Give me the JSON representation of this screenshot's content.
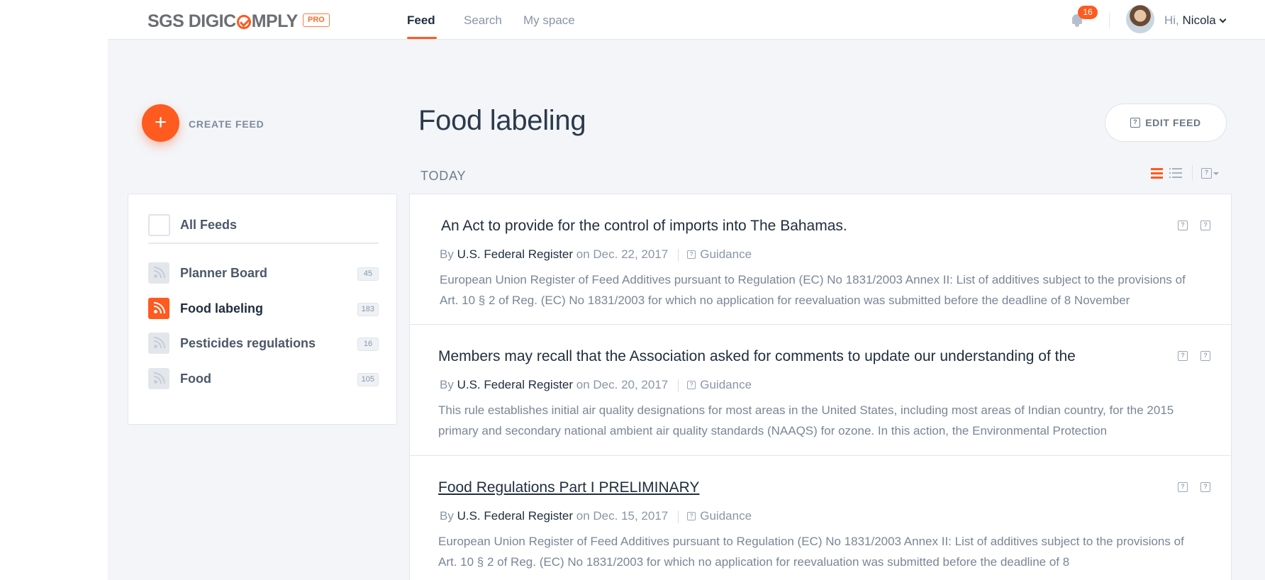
{
  "brand": {
    "name_part1": "SGS DIGIC",
    "name_part2": "MPLY",
    "badge": "PRO",
    "accent_color": "#ff5a1f"
  },
  "nav": {
    "tabs": [
      {
        "label": "Feed",
        "active": true
      },
      {
        "label": "Search"
      },
      {
        "label": "My space"
      }
    ]
  },
  "notifications": {
    "count": "16"
  },
  "user": {
    "greeting": "Hi,",
    "name": "Nicola"
  },
  "sidebar": {
    "create_label": "CREATE FEED",
    "all_feeds_label": "All Feeds",
    "feeds": [
      {
        "name": "Planner Board",
        "count": "45"
      },
      {
        "name": "Food labeling",
        "count": "183",
        "active": true
      },
      {
        "name": "Pesticides regulations",
        "count": "16"
      },
      {
        "name": "Food",
        "count": "105"
      }
    ]
  },
  "main": {
    "title": "Food labeling",
    "edit_label": "EDIT FEED",
    "section_label": "TODAY",
    "articles": [
      {
        "title": "An Act to provide for the control of imports into The Bahamas.",
        "by": "By",
        "source": "U.S. Federal Register",
        "date": "on Dec. 22, 2017",
        "type": "Guidance",
        "description": "European Union Register of Feed Additives pursuant to Regulation (EC) No 1831/2003 Annex II: List of additives subject to the provisions of Art. 10 § 2 of Reg. (EC) No 1831/2003 for which no application for reevaluation was submitted before the deadline of 8 November"
      },
      {
        "title": "Members may recall that the Association asked for comments to update our understanding of the",
        "by": "By",
        "source": "U.S. Federal Register",
        "date": "on Dec. 20, 2017",
        "type": "Guidance",
        "description": "This rule establishes initial air quality designations for most areas in the United States, including most areas of Indian country, for the 2015 primary and secondary national ambient air quality standards (NAAQS) for ozone. In this action, the Environmental Protection"
      },
      {
        "title": "Food Regulations Part I PRELIMINARY",
        "by": "By",
        "source": "U.S. Federal Register",
        "date": "on Dec. 15, 2017",
        "type": "Guidance",
        "description": "European Union Register of Feed Additives pursuant to Regulation (EC) No 1831/2003 Annex II: List of additives subject to the provisions of Art. 10 § 2 of Reg. (EC) No 1831/2003 for which no application for reevaluation was submitted before the deadline of 8"
      }
    ]
  }
}
